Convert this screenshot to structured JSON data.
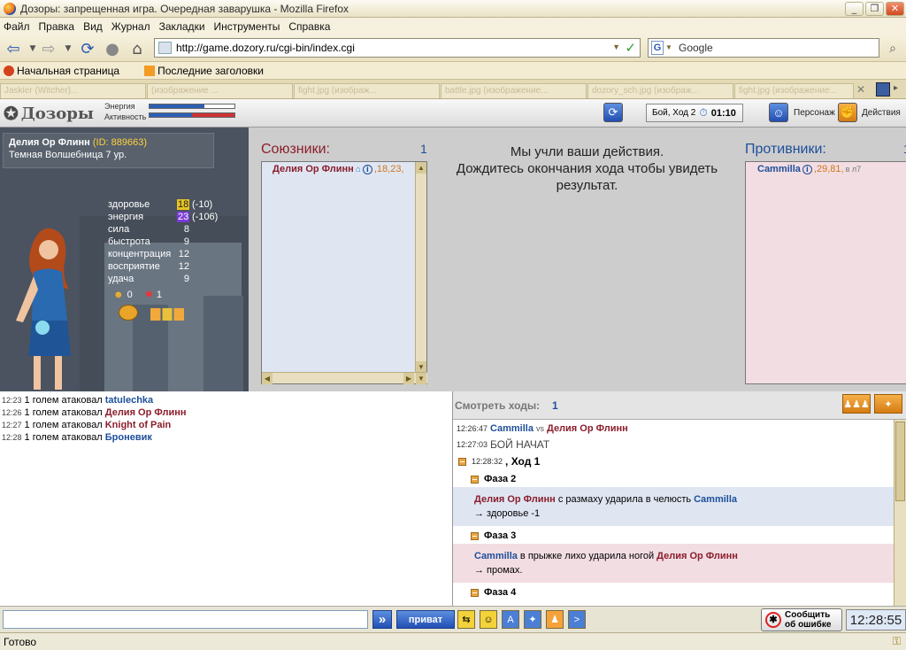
{
  "window": {
    "title": "Дозоры: запрещенная игра. Очередная заварушка - Mozilla Firefox",
    "btn_min": "_",
    "btn_max": "❐",
    "btn_close": "✕"
  },
  "menu": [
    "Файл",
    "Правка",
    "Вид",
    "Журнал",
    "Закладки",
    "Инструменты",
    "Справка"
  ],
  "nav": {
    "url": "http://game.dozory.ru/cgi-bin/index.cgi",
    "search_engine_glyph": "G",
    "search_text": "Google"
  },
  "bookmarks": [
    "Начальная страница",
    "Последние заголовки"
  ],
  "tabs": [
    "Jaskier (Witcher)...",
    "(изображение ...",
    "fight.jpg (изображ...",
    "battle.jpg (изображение...",
    "dozory_sch.jpg (изображ...",
    "fight.jpg (изображение..."
  ],
  "game_header": {
    "logo": "Дозоры",
    "energy_label": "Энергия",
    "activity_label": "Активность",
    "energy_fraction": 0.65,
    "activity_fraction": 0.5,
    "turn_label": "Бой, Ход 2",
    "timer": "01:10",
    "person_label": "Персонаж",
    "actions_label": "Действия"
  },
  "character": {
    "name": "Делия Ор Флинн",
    "id_text": "(ID: 889663)",
    "class_level": "Темная Волшебница 7 ур.",
    "stats": [
      {
        "label": "здоровье",
        "value": "18",
        "delta": "(-10)",
        "hl": "y"
      },
      {
        "label": "энергия",
        "value": "23",
        "delta": "(-106)",
        "hl": "p"
      },
      {
        "label": "сила",
        "value": "8",
        "delta": "",
        "hl": ""
      },
      {
        "label": "быстрота",
        "value": "9",
        "delta": "",
        "hl": ""
      },
      {
        "label": "концентрация",
        "value": "12",
        "delta": "",
        "hl": ""
      },
      {
        "label": "восприятие",
        "value": "12",
        "delta": "",
        "hl": ""
      },
      {
        "label": "удача",
        "value": "9",
        "delta": "",
        "hl": ""
      }
    ],
    "counter1": "0",
    "counter2": "1"
  },
  "allies": {
    "title": "Союзники:",
    "count": "1",
    "members": [
      {
        "name": "Делия Ор Флинн",
        "stats": ",18,23,"
      }
    ]
  },
  "center_message": {
    "line1": "Мы учли ваши действия.",
    "line2": "Дождитесь окончания хода чтобы увидеть",
    "line3": "результат."
  },
  "enemies": {
    "title": "Противники:",
    "count": "1",
    "members": [
      {
        "name": "Cammilla",
        "stats": ",29,81,",
        "extra": "в л7"
      }
    ]
  },
  "chat": [
    {
      "time": "12:23",
      "text": "1 голем атаковал",
      "target": "tatulechka",
      "side": "enemy"
    },
    {
      "time": "12:26",
      "text": "1 голем атаковал",
      "target": "Делия Ор Флинн",
      "side": "ally"
    },
    {
      "time": "12:27",
      "text": "1 голем атаковал",
      "target": "Knight of Pain",
      "side": "ally"
    },
    {
      "time": "12:28",
      "text": "1 голем атаковал",
      "target": "Броневик",
      "side": "enemy"
    }
  ],
  "log": {
    "header_label": "Смотреть ходы:",
    "header_num": "1",
    "fight_time": "12:26:47",
    "fighter_a": "Cammilla",
    "vs": "vs",
    "fighter_b": "Делия Ор Флинн",
    "start_time": "12:27:03",
    "start_text": "БОЙ НАЧАТ",
    "turn_time": "12:28:32",
    "turn_text": ", Ход 1",
    "phase2": "Фаза 2",
    "phase2_actor": "Делия Ор Флинн",
    "phase2_action": "с размаху ударила в челюсть",
    "phase2_target": "Cammilla",
    "phase2_result": "→ здоровье -1",
    "phase3": "Фаза 3",
    "phase3_actor": "Cammilla",
    "phase3_action": "в прыжке лихо ударила ногой",
    "phase3_target": "Делия Ор Флинн",
    "phase3_result": "→ промах.",
    "phase4": "Фаза 4"
  },
  "bottom": {
    "send_glyph": "»",
    "private_label": "приват",
    "report_line1": "Сообщить",
    "report_line2": "об ошибке",
    "clock": "12:28:55"
  },
  "status": "Готово",
  "colors": {
    "ally": "#8b1e2c",
    "enemy": "#1d4f9a",
    "accent": "#e9a43e"
  }
}
